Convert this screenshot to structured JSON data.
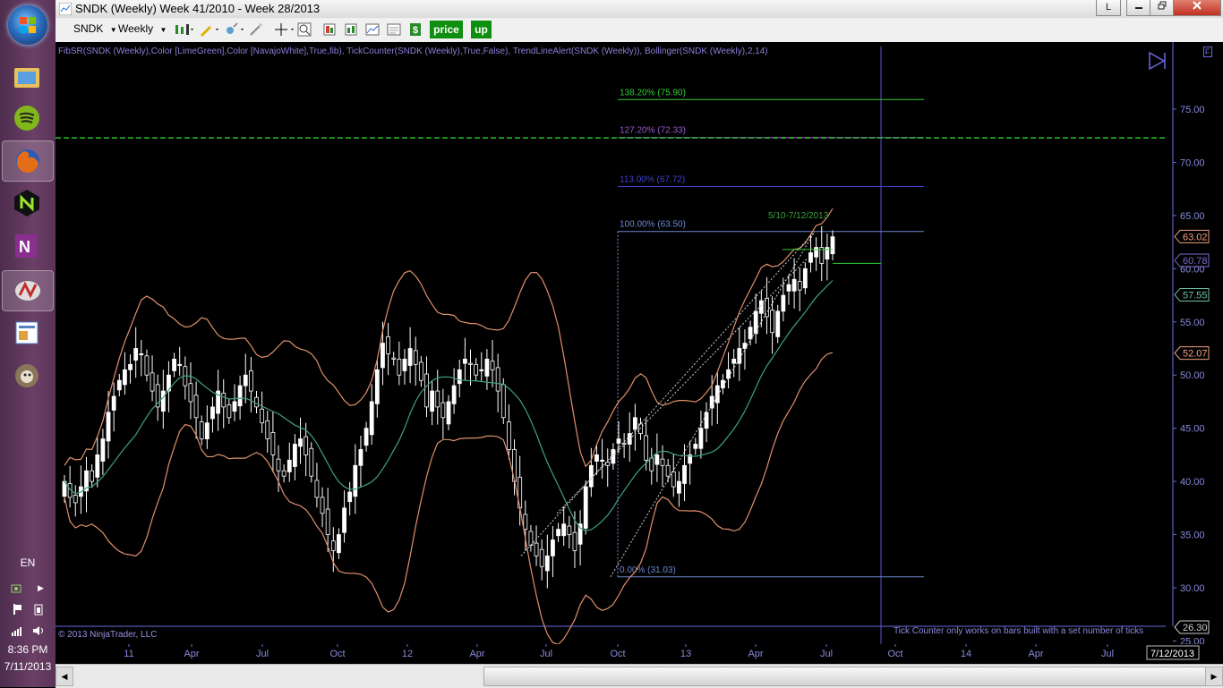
{
  "window": {
    "title": "SNDK (Weekly)  Week 41/2010 - Week 28/2013",
    "btn_l": "L"
  },
  "toolbar": {
    "instrument": "SNDK",
    "interval": "Weekly",
    "price_label": "price",
    "up_label": "up"
  },
  "chart": {
    "indicators_text": "FibSR(SNDK (Weekly),Color [LimeGreen],Color [NavajoWhite],True,fib), TickCounter(SNDK (Weekly),True,False), TrendLineAlert(SNDK (Weekly)), Bollinger(SNDK (Weekly),2,14)",
    "copyright": "© 2013 NinjaTrader, LLC",
    "tick_message": "Tick Counter only works on bars built with a set number of ticks",
    "annotation": "5/10-7/12/2013"
  },
  "chart_data": {
    "type": "candlestick",
    "price_axis_ticks": [
      "75.00",
      "70.00",
      "65.00",
      "60.00",
      "55.00",
      "50.00",
      "45.00",
      "40.00",
      "35.00",
      "30.00",
      "25.00"
    ],
    "ylim": [
      25,
      78
    ],
    "time_axis_ticks": [
      "11",
      "Apr",
      "Jul",
      "Oct",
      "12",
      "Apr",
      "Jul",
      "Oct",
      "13",
      "Apr",
      "Jul",
      "Oct",
      "14",
      "Apr",
      "Jul"
    ],
    "date_badge": "7/12/2013",
    "fib_levels": [
      {
        "label": "138.20% (75.90)",
        "value": 75.9,
        "color": "#32cd32"
      },
      {
        "label": "127.20% (72.33)",
        "value": 72.33,
        "color": "#9b59d0"
      },
      {
        "label": "113.00% (67.72)",
        "value": 67.72,
        "color": "#4040d0"
      },
      {
        "label": "100.00% (63.50)",
        "value": 63.5,
        "color": "#6a8ad0"
      },
      {
        "label": "0.00% (31.03)",
        "value": 31.03,
        "color": "#6a8ad0"
      }
    ],
    "price_badges": [
      {
        "label": "63.02",
        "value": 63.02,
        "color": "#f0a080"
      },
      {
        "label": "60.78",
        "value": 60.78,
        "color": "#7a6ac8"
      },
      {
        "label": "57.55",
        "value": 57.55,
        "color": "#6fc0a0"
      },
      {
        "label": "52.07",
        "value": 52.07,
        "color": "#f0a080"
      },
      {
        "label": "26.30",
        "value": 26.3,
        "color": "#cccccc"
      }
    ],
    "dashed_level": 72.3,
    "closes": [
      40.0,
      38.5,
      38.0,
      39.5,
      41.0,
      40.0,
      42.5,
      44.0,
      46.5,
      48.0,
      49.5,
      50.5,
      51.0,
      52.5,
      52.0,
      50.0,
      48.5,
      47.0,
      48.5,
      50.0,
      51.5,
      51.0,
      49.0,
      47.5,
      46.0,
      44.0,
      45.5,
      47.0,
      48.5,
      47.0,
      46.0,
      47.5,
      49.0,
      50.0,
      48.5,
      47.0,
      45.5,
      44.0,
      42.5,
      41.0,
      40.5,
      42.0,
      43.5,
      44.0,
      42.5,
      40.5,
      38.5,
      37.0,
      35.0,
      33.5,
      35.0,
      37.5,
      39.0,
      41.5,
      43.0,
      45.0,
      47.5,
      50.5,
      53.0,
      52.0,
      51.5,
      50.0,
      51.5,
      52.5,
      51.0,
      49.5,
      47.0,
      48.5,
      47.0,
      46.0,
      47.5,
      49.0,
      50.5,
      51.5,
      51.0,
      50.0,
      50.5,
      51.5,
      50.5,
      48.5,
      46.0,
      43.0,
      40.0,
      37.5,
      35.5,
      34.0,
      33.0,
      32.0,
      33.0,
      34.5,
      35.5,
      36.0,
      35.0,
      33.5,
      36.0,
      39.5,
      41.5,
      42.5,
      42.0,
      41.5,
      43.0,
      44.0,
      43.5,
      44.5,
      46.0,
      44.5,
      42.0,
      41.0,
      42.5,
      41.5,
      40.5,
      39.5,
      40.0,
      41.5,
      42.5,
      43.5,
      45.0,
      46.5,
      48.0,
      49.0,
      49.5,
      50.5,
      51.5,
      52.5,
      53.0,
      54.5,
      56.0,
      57.0,
      55.5,
      54.0,
      56.0,
      57.5,
      58.5,
      59.0,
      58.0,
      60.0,
      61.5,
      62.0,
      60.5,
      62.0,
      63.0
    ],
    "bollinger_x_start": 67,
    "bollinger_x_end": 925
  },
  "taskbar": {
    "language": "EN",
    "time": "8:36 PM",
    "date": "7/11/2013"
  }
}
